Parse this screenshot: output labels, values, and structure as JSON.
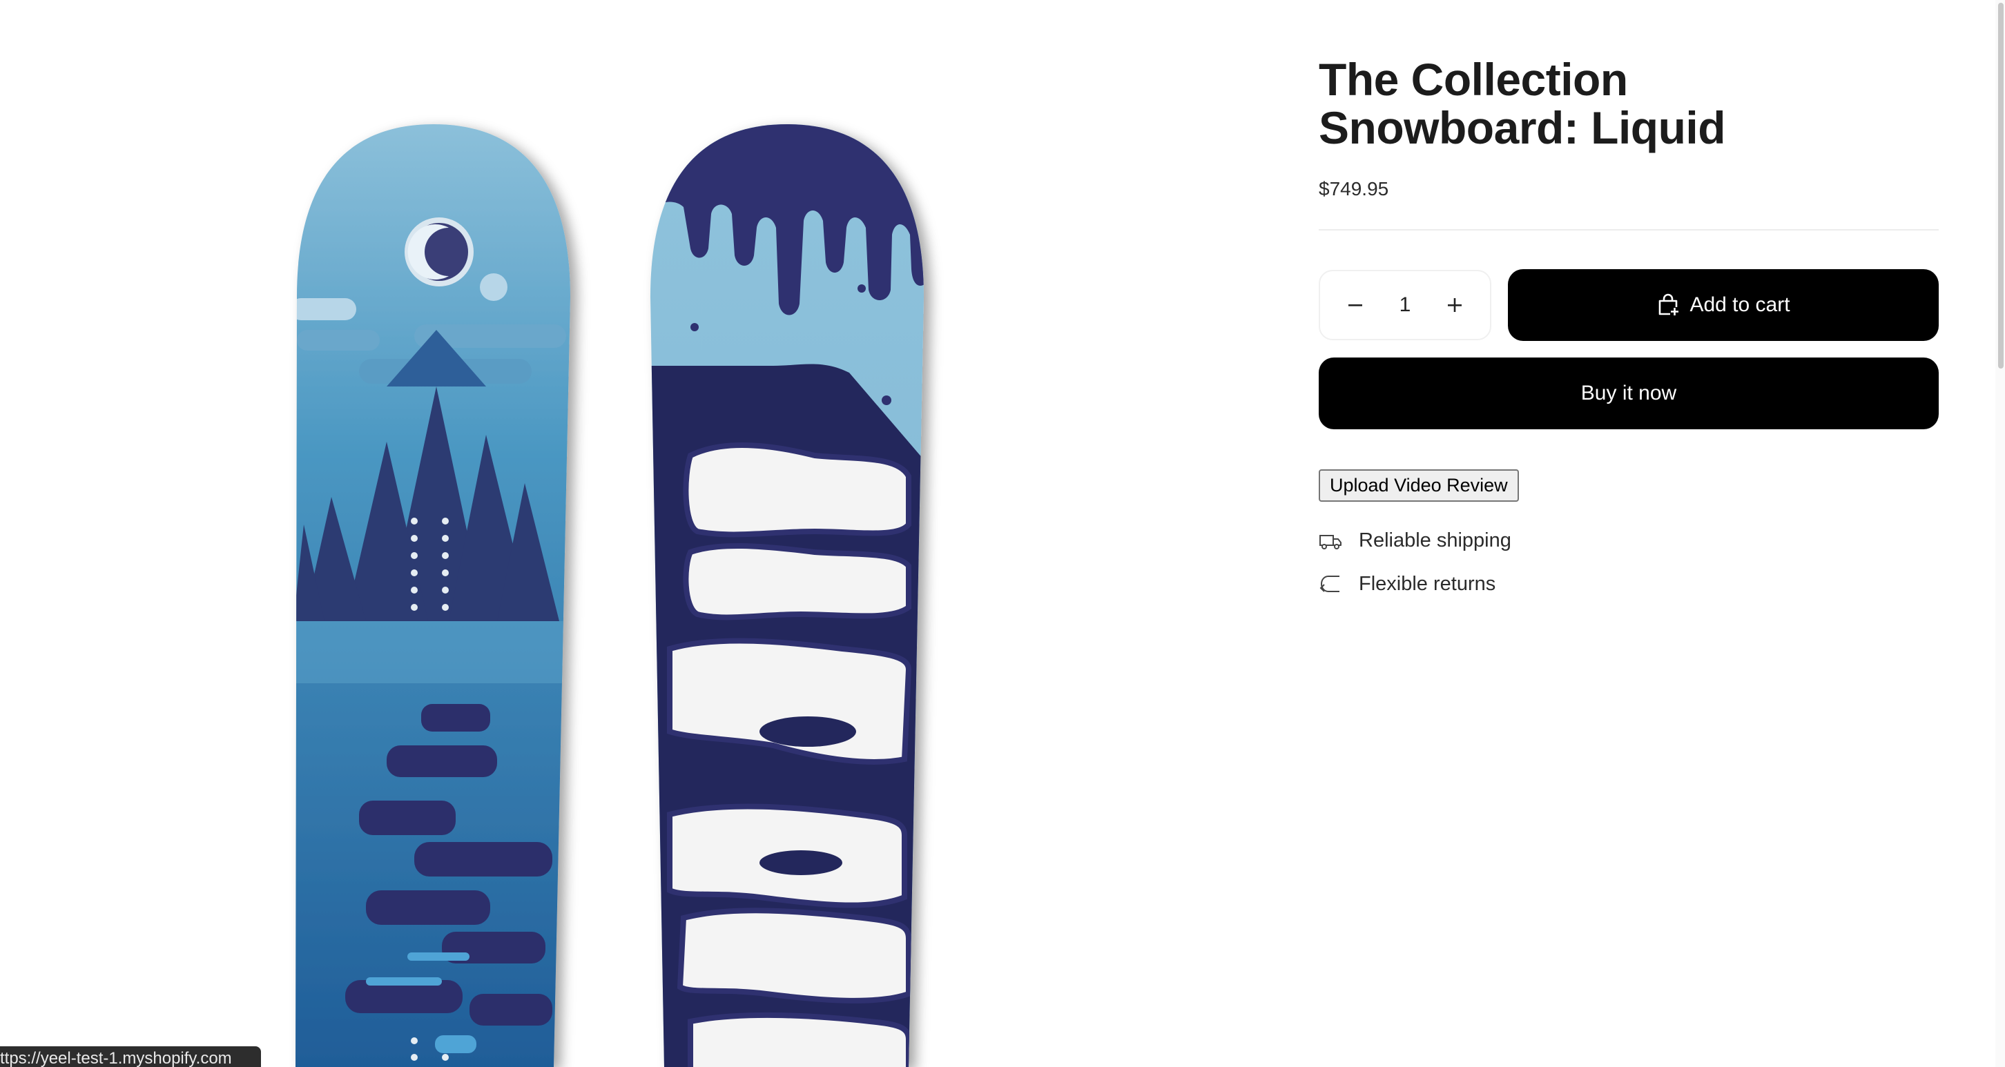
{
  "product": {
    "title": "The Collection Snowboard: Liquid",
    "price": "$749.95",
    "image_alt": "The Collection Snowboard: Liquid"
  },
  "quantity": {
    "value": "1",
    "decrease_icon": "minus-icon",
    "increase_icon": "plus-icon"
  },
  "actions": {
    "add_to_cart": "Add to cart",
    "add_to_cart_icon": "cart-add-icon",
    "buy_now": "Buy it now",
    "upload_review": "Upload Video Review"
  },
  "features": [
    {
      "label": "Reliable shipping",
      "icon": "truck-icon"
    },
    {
      "label": "Flexible returns",
      "icon": "return-arrow-icon"
    }
  ],
  "status_bar": {
    "url": "ttps://yeel-test-1.myshopify.com"
  },
  "colors": {
    "button_bg": "#000000",
    "button_text": "#ffffff",
    "board_light": "#7fb1cf",
    "board_mid": "#3c8ab8",
    "board_dark": "#2b2c66"
  }
}
